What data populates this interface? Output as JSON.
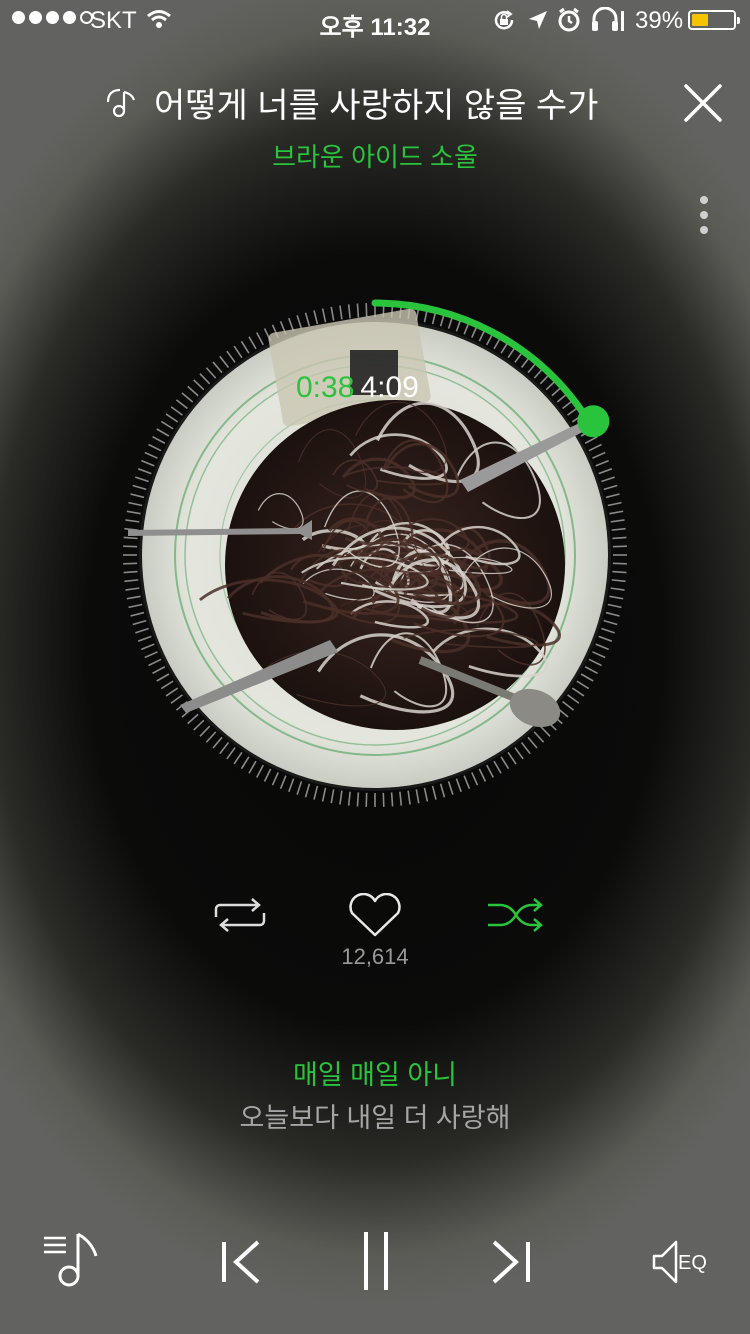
{
  "status_bar": {
    "carrier": "SKT",
    "time": "오후 11:32",
    "battery_percent": "39%",
    "battery_level": 0.39,
    "icons": [
      "signal-dots-icon",
      "wifi-icon",
      "rotation-lock-icon",
      "location-icon",
      "alarm-icon",
      "headphones-icon",
      "battery-icon"
    ]
  },
  "track": {
    "title": "어떻게 너를 사랑하지 않을 수가",
    "artist": "브라운 아이드 소울",
    "current_time": "0:38",
    "total_time": "4:09",
    "progress": 0.153
  },
  "actions": {
    "like_count": "12,614"
  },
  "lyrics": {
    "current_line": "매일 매일 아니",
    "next_line": "오늘보다 내일 더 사랑해"
  },
  "bottom_bar": {
    "eq_label": "EQ"
  },
  "colors": {
    "accent": "#29c43b",
    "background": "#0b0b0a",
    "text_secondary": "#a5a5a5"
  }
}
